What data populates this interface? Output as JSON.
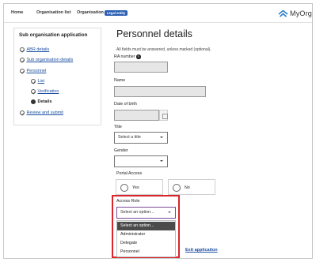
{
  "header": {
    "nav": [
      "Home",
      "Organisation list",
      "Organisation"
    ],
    "badge": "Legal entity",
    "brand": "MyOrg"
  },
  "sidebar": {
    "title": "Sub organisation application",
    "items": [
      {
        "label": "ABR details",
        "state": "done"
      },
      {
        "label": "Sub organisation details",
        "state": "done"
      },
      {
        "label": "Personnel",
        "state": "done"
      },
      {
        "label": "List",
        "state": "done"
      },
      {
        "label": "Verification",
        "state": "done"
      },
      {
        "label": "Details",
        "state": "current"
      },
      {
        "label": "Review and submit",
        "state": "done"
      }
    ]
  },
  "main": {
    "title": "Personnel details",
    "hint": "All fields must be answered, unless marked (optional).",
    "ra_label": "RA number",
    "name_label": "Name",
    "dob_label": "Date of birth",
    "title_label": "Title",
    "title_placeholder": "Select a title",
    "gender_label": "Gender",
    "portal_label": "Portal Access",
    "portal_options": [
      "Yes",
      "No"
    ],
    "role_label": "Access Role",
    "role_placeholder": "Select an option...",
    "role_options": [
      "Select an option...",
      "Administrator",
      "Delegate",
      "Personnel"
    ],
    "exit_link": "Exit application"
  },
  "colors": {
    "highlight": "#d9262c",
    "link": "#1b4ea0",
    "badge": "#2b5fb3"
  }
}
